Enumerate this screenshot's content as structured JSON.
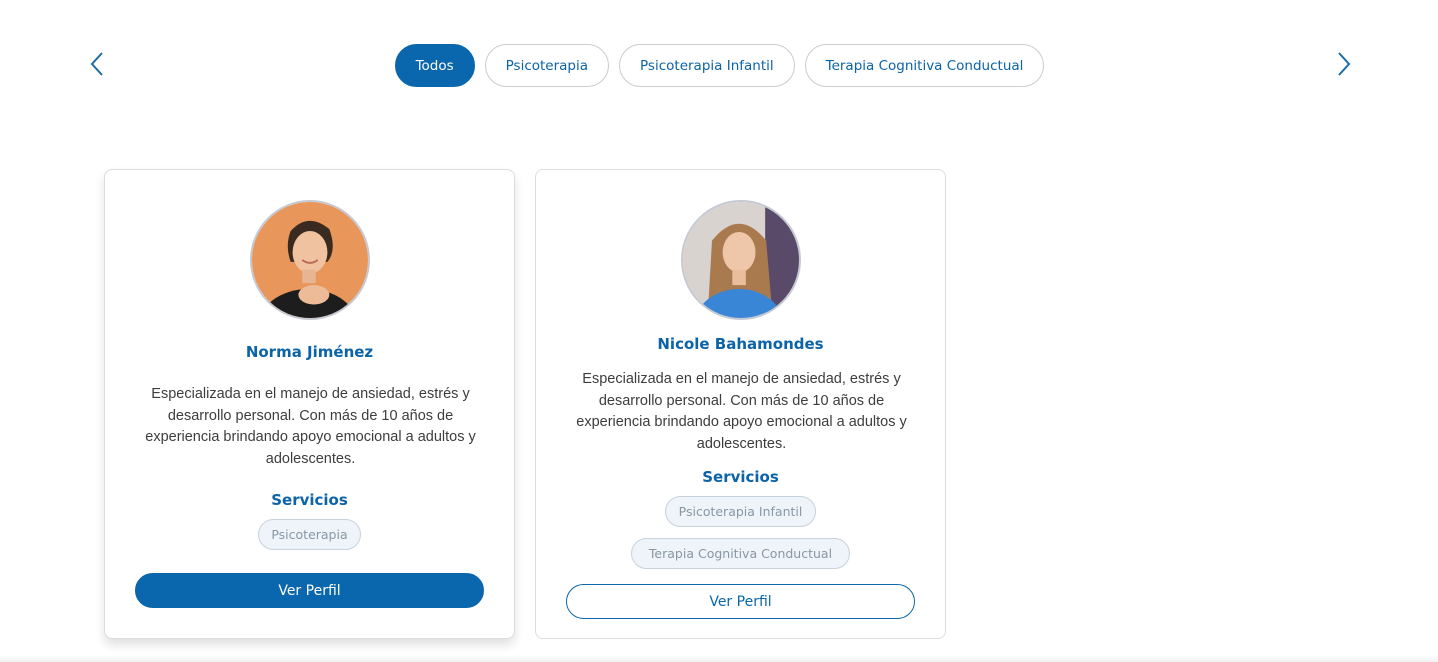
{
  "filters": {
    "items": [
      {
        "label": "Todos",
        "active": true
      },
      {
        "label": "Psicoterapia",
        "active": false
      },
      {
        "label": "Psicoterapia Infantil",
        "active": false
      },
      {
        "label": "Terapia Cognitiva Conductual",
        "active": false
      }
    ],
    "prev_icon": "chevron-left-icon",
    "next_icon": "chevron-right-icon"
  },
  "cards": [
    {
      "name": "Norma Jiménez",
      "description": "Especializada en el manejo de ansiedad, estrés y desarrollo personal. Con más de 10 años de experiencia brindando apoyo emocional a adultos y adolescentes.",
      "services_title": "Servicios",
      "services": [
        "Psicoterapia"
      ],
      "button_label": "Ver Perfil"
    },
    {
      "name": "Nicole Bahamondes",
      "description": "Especializada en el manejo de ansiedad, estrés y desarrollo personal. Con más de 10 años de experiencia brindando apoyo emocional a adultos y adolescentes.",
      "services_title": "Servicios",
      "services": [
        "Psicoterapia Infantil",
        "Terapia Cognitiva Conductual"
      ],
      "button_label": "Ver Perfil"
    }
  ],
  "colors": {
    "primary": "#0a66ad",
    "tag_bg": "#eef4fa",
    "tag_text": "#8a97a3"
  }
}
